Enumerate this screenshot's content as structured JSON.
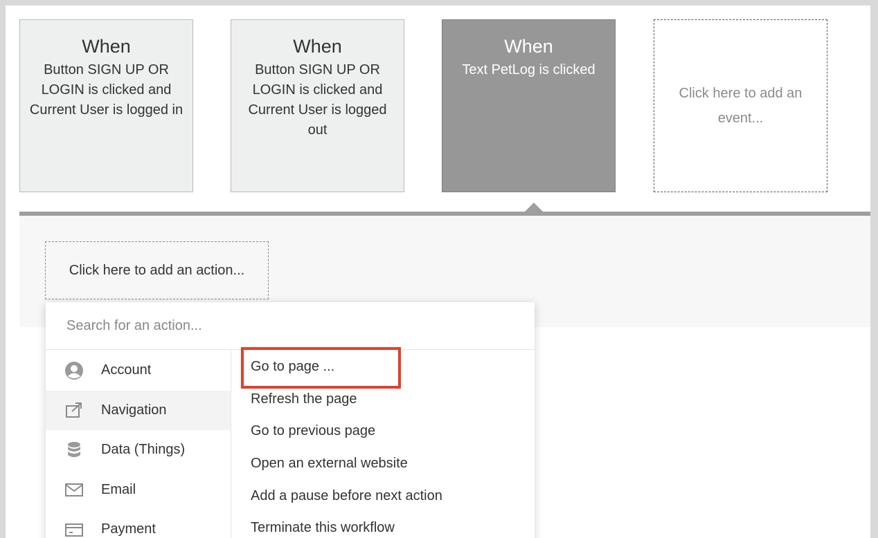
{
  "events": [
    {
      "when": "When",
      "description": "Button SIGN UP OR LOGIN is clicked and Current User is logged in",
      "selected": false
    },
    {
      "when": "When",
      "description": "Button SIGN UP OR LOGIN is clicked and Current User is logged out",
      "selected": false
    },
    {
      "when": "When",
      "description": "Text PetLog is clicked",
      "selected": true
    }
  ],
  "add_event_label": "Click here to add an event...",
  "add_action_label": "Click here to add an action...",
  "search": {
    "placeholder": "Search for an action..."
  },
  "categories": [
    {
      "label": "Account",
      "icon": "account-icon"
    },
    {
      "label": "Navigation",
      "icon": "navigation-icon",
      "active": true
    },
    {
      "label": "Data (Things)",
      "icon": "database-icon"
    },
    {
      "label": "Email",
      "icon": "email-icon"
    },
    {
      "label": "Payment",
      "icon": "payment-icon"
    }
  ],
  "actions": [
    "Go to page ...",
    "Refresh the page",
    "Go to previous page",
    "Open an external website",
    "Add a pause before next action",
    "Terminate this workflow"
  ],
  "colors": {
    "highlight": "#e2402d",
    "selected_event": "#979797",
    "panel_border": "#9e9e9e"
  }
}
